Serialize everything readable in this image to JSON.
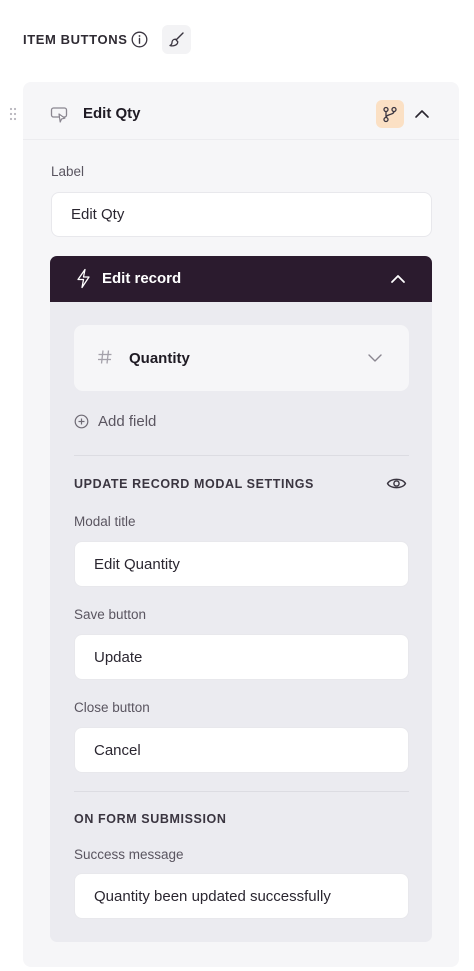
{
  "section": {
    "title": "ITEM BUTTONS"
  },
  "item": {
    "title": "Edit Qty",
    "label_caption": "Label",
    "label_value": "Edit Qty"
  },
  "action": {
    "title": "Edit record",
    "field_name": "Quantity",
    "add_field_label": "Add field"
  },
  "modal_settings": {
    "heading": "UPDATE RECORD MODAL SETTINGS",
    "modal_title_caption": "Modal title",
    "modal_title_value": "Edit Quantity",
    "save_caption": "Save button",
    "save_value": "Update",
    "close_caption": "Close button",
    "close_value": "Cancel"
  },
  "submission": {
    "heading": "ON FORM SUBMISSION",
    "success_caption": "Success message",
    "success_value": "Quantity been updated successfully"
  },
  "colors": {
    "panel_header": "#2b1b2e",
    "branch_button_bg": "#fbe0c4",
    "card_bg": "#f6f6f8",
    "panel_bg": "#ebebf0"
  },
  "icons": [
    "info-icon",
    "brush-icon",
    "drag-handle-icon",
    "button-icon",
    "branch-icon",
    "chevron-up-icon",
    "bolt-icon",
    "hash-icon",
    "chevron-down-icon",
    "plus-circle-icon",
    "eye-icon"
  ]
}
